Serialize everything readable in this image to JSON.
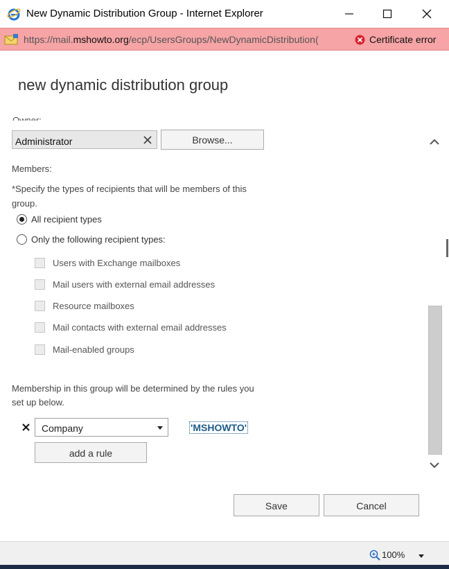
{
  "window": {
    "title": "New Dynamic Distribution Group - Internet Explorer"
  },
  "address_bar": {
    "url_prefix": "https://mail.",
    "url_host": "mshowto.org",
    "url_path": "/ecp/UsersGroups/NewDynamicDistribution(",
    "certificate_status": "Certificate error"
  },
  "page": {
    "title": "new dynamic distribution group",
    "owner_label": "Owner:",
    "owner_value": "Administrator",
    "browse_label": "Browse...",
    "members_label": "Members:",
    "members_hint": "*Specify the types of recipients that will be members of this group.",
    "recipient_options": [
      {
        "label": "All recipient types",
        "selected": true
      },
      {
        "label": "Only the following recipient types:",
        "selected": false
      }
    ],
    "recipient_types": [
      {
        "label": "Users with Exchange mailboxes",
        "checked": false
      },
      {
        "label": "Mail users with external email addresses",
        "checked": false
      },
      {
        "label": "Resource mailboxes",
        "checked": false
      },
      {
        "label": "Mail contacts with external email addresses",
        "checked": false
      },
      {
        "label": "Mail-enabled groups",
        "checked": false
      }
    ],
    "membership_text": "Membership in this group will be determined by the rules you set up below.",
    "rule": {
      "attribute": "Company",
      "value": "'MSHOWTO'"
    },
    "add_rule_label": "add a rule",
    "save_label": "Save",
    "cancel_label": "Cancel"
  },
  "status_bar": {
    "zoom": "100%"
  },
  "colors": {
    "address_bar_bg": "#f6a4a6",
    "cert_error_red": "#d9232e",
    "ie_blue": "#1e74d6",
    "link_blue": "#1d5b89"
  }
}
